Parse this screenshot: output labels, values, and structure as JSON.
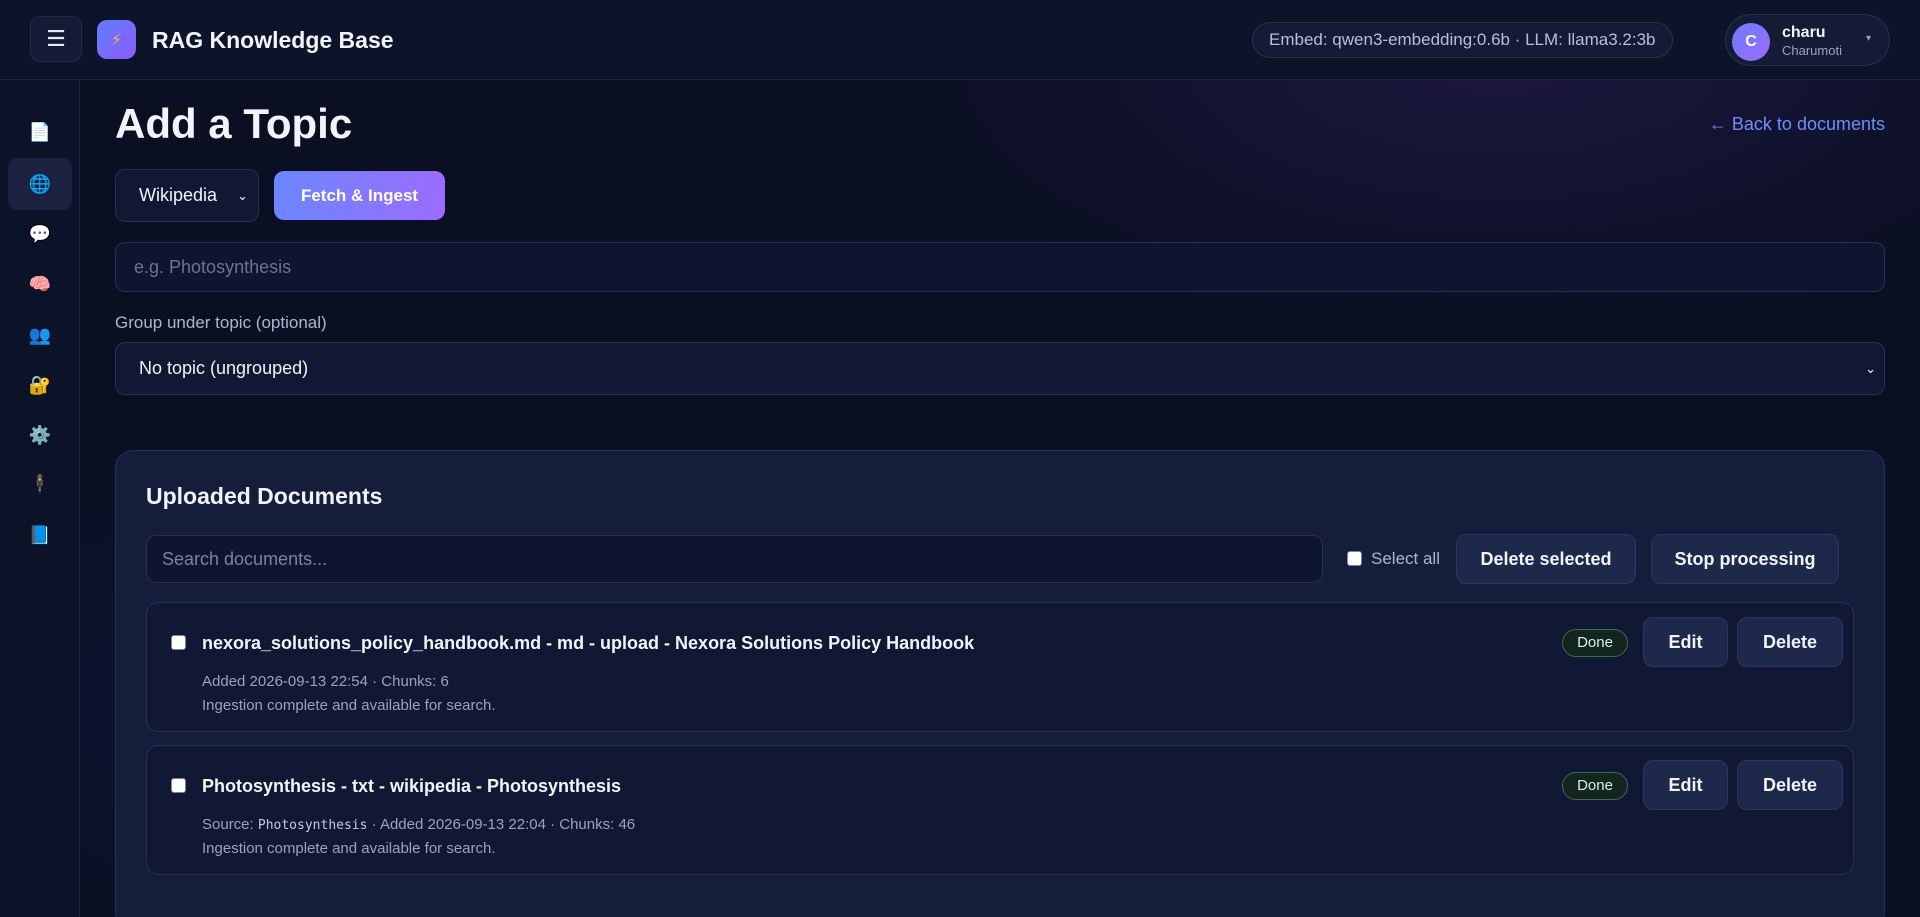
{
  "header": {
    "menu_icon": "☰",
    "logo_icon": "⚡",
    "app_title": "RAG Knowledge Base",
    "model_info": "Embed: qwen3-embedding:0.6b · LLM: llama3.2:3b",
    "user": {
      "initial": "C",
      "name": "charu",
      "subtitle": "Charumoti",
      "caret": "▾"
    }
  },
  "sidebar": {
    "items": [
      {
        "name": "documents",
        "icon": "📄",
        "active": false
      },
      {
        "name": "web-topic",
        "icon": "🌐",
        "active": true
      },
      {
        "name": "chat",
        "icon": "💬",
        "active": false
      },
      {
        "name": "memory",
        "icon": "🧠",
        "active": false
      },
      {
        "name": "users",
        "icon": "👥",
        "active": false
      },
      {
        "name": "security",
        "icon": "🔐",
        "active": false
      },
      {
        "name": "settings",
        "icon": "⚙️",
        "active": false
      },
      {
        "name": "agent",
        "icon": "🕴",
        "active": false
      },
      {
        "name": "docs",
        "icon": "📘",
        "active": false
      }
    ]
  },
  "main": {
    "title": "Add a Topic",
    "back_link": "← Back to documents",
    "source_select": {
      "value": "Wikipedia",
      "caret": "⌄"
    },
    "fetch_button": "Fetch & Ingest",
    "topic_input": {
      "placeholder": "e.g. Photosynthesis"
    },
    "group_label": "Group under topic (optional)",
    "group_select": {
      "value": "No topic (ungrouped)",
      "caret": "⌄"
    }
  },
  "documents": {
    "title": "Uploaded Documents",
    "search_placeholder": "Search documents...",
    "select_all_label": "Select all",
    "delete_selected_label": "Delete selected",
    "stop_processing_label": "Stop processing",
    "items": [
      {
        "name": "nexora_solutions_policy_handbook.md - md - upload - Nexora Solutions Policy Handbook",
        "meta_prefix": "",
        "source": "",
        "meta": "Added 2026-09-13 22:54 · Chunks: 6",
        "status_text": "Ingestion complete and available for search.",
        "badge": "Done",
        "edit_label": "Edit",
        "delete_label": "Delete"
      },
      {
        "name": "Photosynthesis - txt - wikipedia - Photosynthesis",
        "meta_prefix": "Source: ",
        "source": "Photosynthesis",
        "meta": " · Added 2026-09-13 22:04 · Chunks: 46",
        "status_text": "Ingestion complete and available for search.",
        "badge": "Done",
        "edit_label": "Edit",
        "delete_label": "Delete"
      }
    ]
  }
}
